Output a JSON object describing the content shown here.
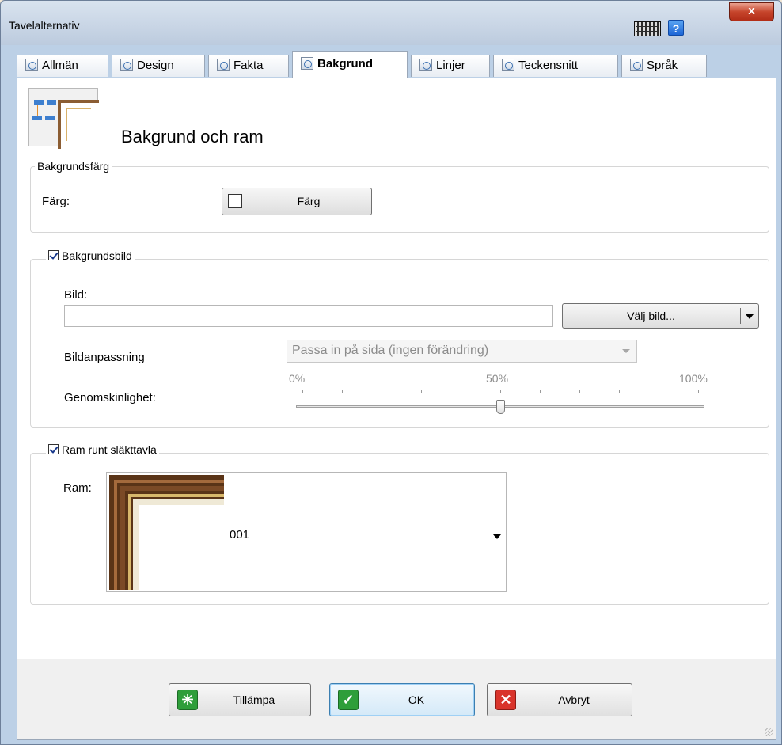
{
  "window": {
    "title": "Tavelalternativ",
    "help_label": "?",
    "close_label": "x"
  },
  "tabs": [
    {
      "label": "Allmän",
      "icon": "general-settings-icon"
    },
    {
      "label": "Design",
      "icon": "design-preview-icon"
    },
    {
      "label": "Fakta",
      "icon": "facts-icon"
    },
    {
      "label": "Bakgrund",
      "icon": "background-icon",
      "active": true
    },
    {
      "label": "Linjer",
      "icon": "lines-icon"
    },
    {
      "label": "Teckensnitt",
      "icon": "font-icon"
    },
    {
      "label": "Språk",
      "icon": "language-icon"
    }
  ],
  "page": {
    "title": "Bakgrund och ram"
  },
  "background_color": {
    "group_label": "Bakgrundsfärg",
    "color_label": "Färg:",
    "color_button": "Färg",
    "swatch_color": "#ffffff"
  },
  "background_image": {
    "checkbox_label": "Bakgrundsbild",
    "checked": true,
    "image_label": "Bild:",
    "image_path": "",
    "choose_button": "Välj bild...",
    "fit_label": "Bildanpassning",
    "fit_value": "Passa in på sida (ingen förändring)",
    "transparency_label": "Genomskinlighet:",
    "scale_min": "0%",
    "scale_mid": "50%",
    "scale_max": "100%",
    "transparency_value": 0.5
  },
  "frame": {
    "checkbox_label": "Ram runt släkttavla",
    "checked": true,
    "frame_label": "Ram:",
    "frame_value": "001"
  },
  "footer": {
    "apply": "Tillämpa",
    "ok": "OK",
    "cancel": "Avbryt"
  },
  "colors": {
    "apply_icon": "#2e9e3a",
    "ok_icon": "#2e9e3a",
    "cancel_icon": "#d9342b"
  }
}
